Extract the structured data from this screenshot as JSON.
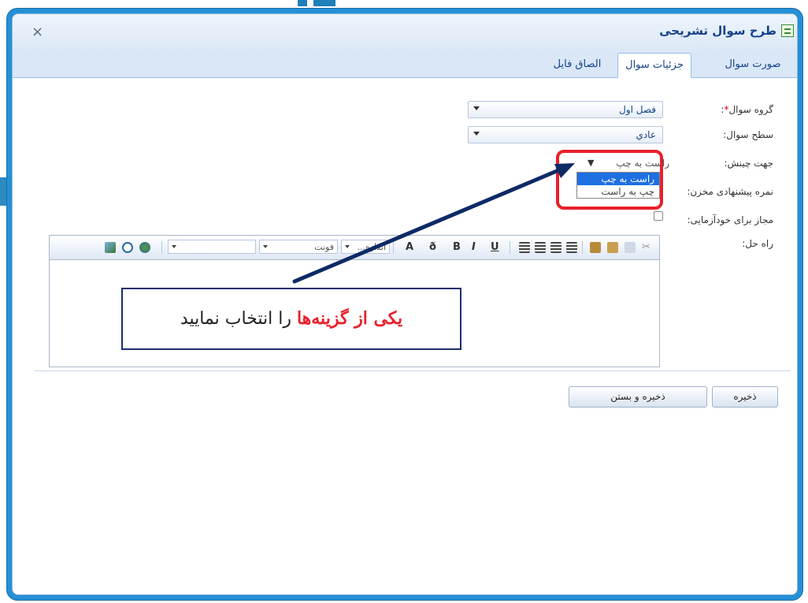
{
  "window": {
    "title": "طرح سوال تشریحی",
    "close_label": "×"
  },
  "tabs": [
    {
      "label": "صورت سوال",
      "active": false
    },
    {
      "label": "جزئیات سوال",
      "active": true
    },
    {
      "label": "الصاق فایل",
      "active": false
    }
  ],
  "form": {
    "group_label": "گروه سوال",
    "group_required_mark": "*",
    "group_colon": ":",
    "group_value": "فصل اول",
    "level_label": "سطح سوال:",
    "level_value": "عادي",
    "direction_label": "جهت چینش:",
    "direction_value": "راست به چپ",
    "direction_options": [
      "راست به چپ",
      "چپ به راست"
    ],
    "score_label": "نمره پیشنهادی مخزن:",
    "self_test_label": "مجاز برای خودآزمایی:",
    "solution_label": "راه حل:"
  },
  "editor": {
    "font_select": "فونت",
    "size_select": "اندازه..."
  },
  "callout": {
    "highlight": "یکی از گزینه‌ها",
    "rest": " را انتخاب نمایید"
  },
  "buttons": {
    "save": "ذخیره",
    "save_close": "ذخیره و بستن"
  },
  "colors": {
    "frame": "#2590d6",
    "highlight_red": "#e8202a",
    "selected_option": "#1e6fe0",
    "arrow": "#0d2a66"
  }
}
